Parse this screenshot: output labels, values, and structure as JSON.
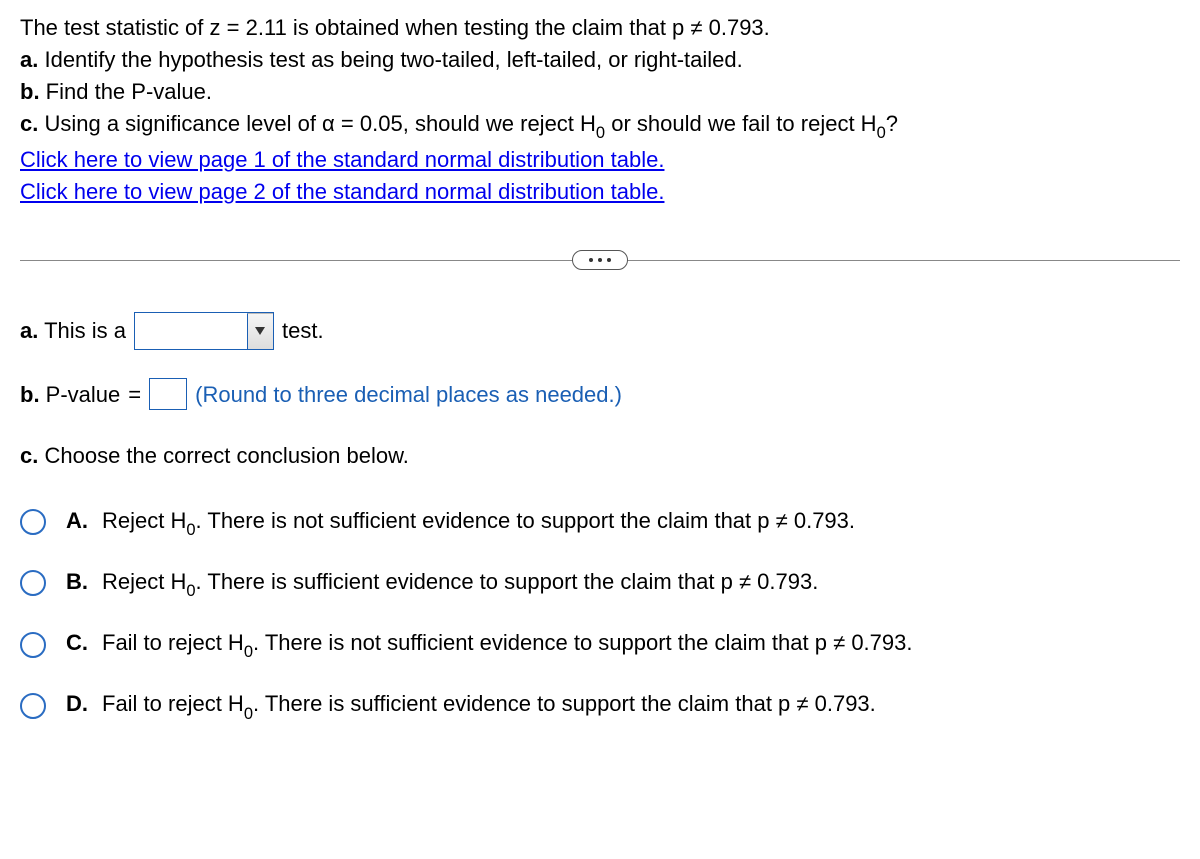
{
  "question": {
    "line1_before": "The test statistic of z",
    "line1_eq": "=",
    "line1_zval": "2.11",
    "line1_mid": " is obtained when testing the claim that p",
    "line1_neq": "≠",
    "line1_pval": "0.793.",
    "a": "a.",
    "a_text": " Identify the hypothesis test as being two-tailed, left-tailed, or right-tailed.",
    "b": "b.",
    "b_text": " Find the P-value.",
    "c": "c.",
    "c_text_1": " Using a significance level of α",
    "c_eq": "=",
    "c_alpha": "0.05",
    "c_text_2": ", should we reject H",
    "c_text_3": " or should we fail to reject H",
    "c_qmark": "?",
    "sub0": "0",
    "link1": "Click here to view page 1 of the standard normal distribution table.",
    "link2": "Click here to view page 2 of the standard normal distribution table."
  },
  "answers": {
    "a_label": "a.",
    "a_text1": " This is a ",
    "a_text2": " test.",
    "dropdown_value": "",
    "b_label": "b.",
    "b_text1": " P-value",
    "b_eq": "=",
    "b_input_value": "",
    "b_hint": "(Round to three decimal places as needed.)",
    "c_label": "c.",
    "c_text": " Choose the correct conclusion below."
  },
  "options": [
    {
      "letter": "A.",
      "text_before": "Reject H",
      "text_after": ". There is not sufficient evidence to support the claim that p",
      "neq": "≠",
      "pval": "0.793."
    },
    {
      "letter": "B.",
      "text_before": "Reject H",
      "text_after": ". There is sufficient evidence to support the claim that p",
      "neq": "≠",
      "pval": "0.793."
    },
    {
      "letter": "C.",
      "text_before": "Fail to reject H",
      "text_after": ". There is not sufficient evidence to support the claim that p",
      "neq": "≠",
      "pval": "0.793."
    },
    {
      "letter": "D.",
      "text_before": "Fail to reject H",
      "text_after": ". There is sufficient evidence to support the claim that p",
      "neq": "≠",
      "pval": "0.793."
    }
  ]
}
